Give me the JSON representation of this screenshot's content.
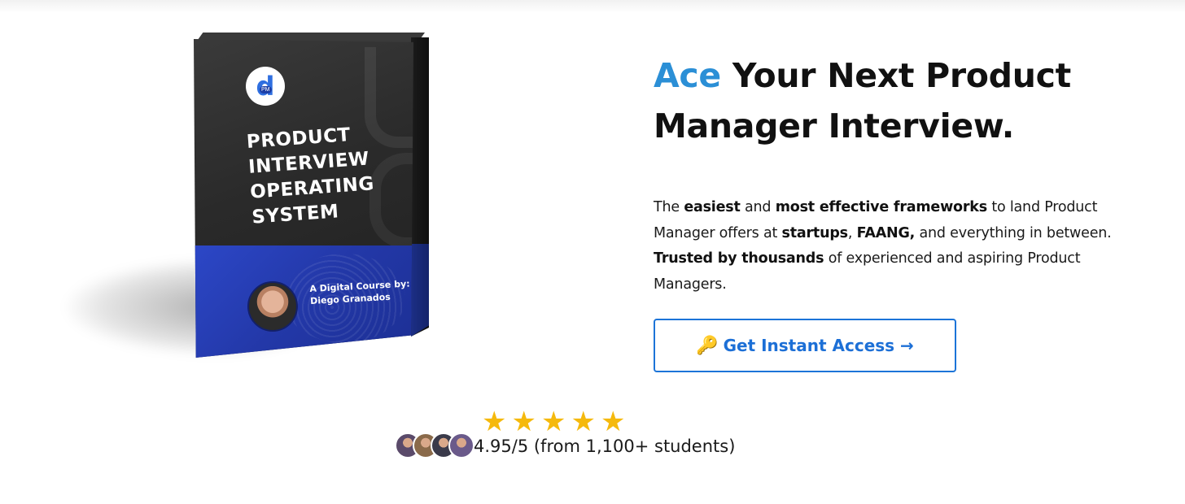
{
  "product_box": {
    "logo_letter": "d",
    "logo_badge": "PM",
    "title_lines": [
      "PRODUCT",
      "INTERVIEW",
      "OPERATING",
      "SYSTEM"
    ],
    "author_lines": [
      "A Digital Course by:",
      "Diego Granados"
    ]
  },
  "hero": {
    "headline_accent": "Ace",
    "headline_rest": " Your Next Product Manager Interview.",
    "description": {
      "p1": "The ",
      "b1": "easiest",
      "p2": " and ",
      "b2": "most effective frameworks",
      "p3": " to land Product Manager offers at ",
      "b3": "startups",
      "p4": ", ",
      "b4": "FAANG,",
      "p5": " and everything in between. ",
      "b5": "Trusted by thousands",
      "p6": " of experienced and aspiring Product Managers."
    },
    "cta": {
      "icon": "🔑",
      "label": "Get Instant Access →"
    }
  },
  "rating": {
    "stars": 5,
    "star_glyph": "★",
    "text": "4.95/5 (from 1,100+ students)",
    "avatar_colors": [
      "#5a4a6a",
      "#8a6a4a",
      "#3a3a4a",
      "#6a5a8a"
    ]
  },
  "colors": {
    "accent_blue": "#2b8fd6",
    "cta_blue": "#1c6fd6",
    "star_gold": "#f5b90d",
    "box_blue": "#2338a8"
  }
}
